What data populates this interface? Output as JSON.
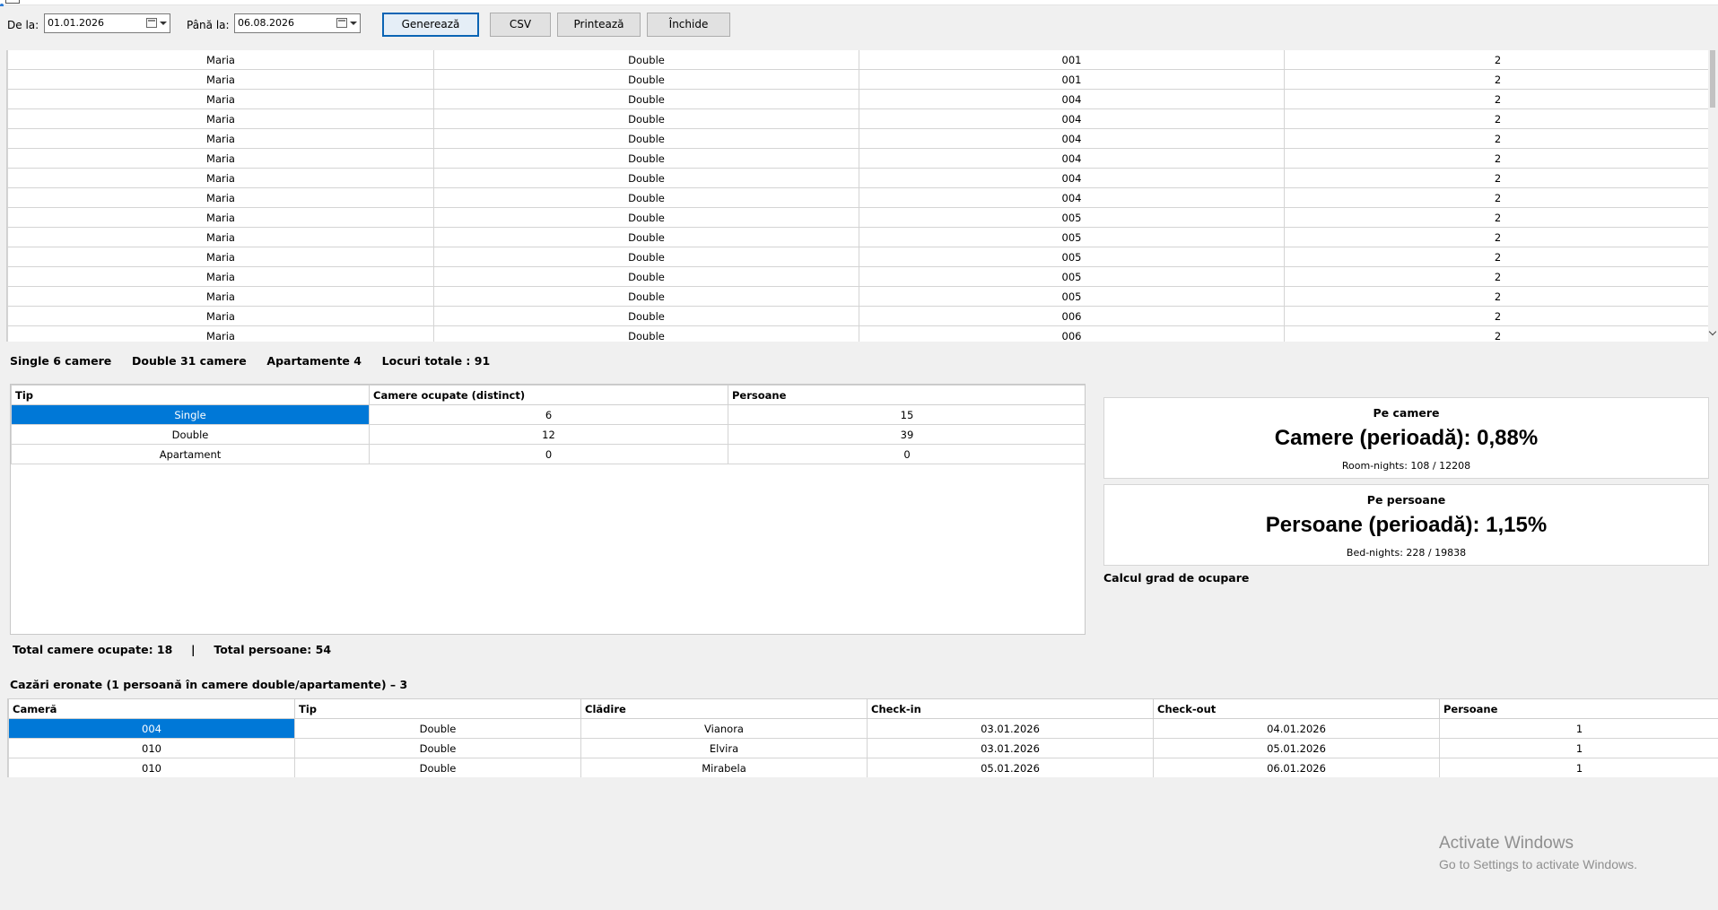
{
  "toolbar": {
    "from_label": "De la:",
    "from_value": "01.01.2026",
    "to_label": "Până la:",
    "to_value": "06.08.2026",
    "generate_label": "Generează",
    "csv_label": "CSV",
    "print_label": "Printează",
    "close_label": "Închide"
  },
  "main_grid": {
    "rows": [
      [
        "Maria",
        "Double",
        "001",
        "2"
      ],
      [
        "Maria",
        "Double",
        "001",
        "2"
      ],
      [
        "Maria",
        "Double",
        "004",
        "2"
      ],
      [
        "Maria",
        "Double",
        "004",
        "2"
      ],
      [
        "Maria",
        "Double",
        "004",
        "2"
      ],
      [
        "Maria",
        "Double",
        "004",
        "2"
      ],
      [
        "Maria",
        "Double",
        "004",
        "2"
      ],
      [
        "Maria",
        "Double",
        "004",
        "2"
      ],
      [
        "Maria",
        "Double",
        "005",
        "2"
      ],
      [
        "Maria",
        "Double",
        "005",
        "2"
      ],
      [
        "Maria",
        "Double",
        "005",
        "2"
      ],
      [
        "Maria",
        "Double",
        "005",
        "2"
      ],
      [
        "Maria",
        "Double",
        "005",
        "2"
      ],
      [
        "Maria",
        "Double",
        "006",
        "2"
      ],
      [
        "Maria",
        "Double",
        "006",
        "2"
      ]
    ]
  },
  "capacity": {
    "single": "Single 6 camere",
    "double": "Double 31 camere",
    "apartments": "Apartamente 4",
    "total": "Locuri totale : 91"
  },
  "summary": {
    "headers": [
      "Tip",
      "Camere ocupate (distinct)",
      "Persoane"
    ],
    "rows": [
      [
        "Single",
        "6",
        "15"
      ],
      [
        "Double",
        "12",
        "39"
      ],
      [
        "Apartament",
        "0",
        "0"
      ]
    ]
  },
  "rooms_card": {
    "subtitle": "Pe camere",
    "headline": "Camere (perioadă): 0,88%",
    "detail": "Room-nights: 108 / 12208"
  },
  "persons_card": {
    "subtitle": "Pe persoane",
    "headline": "Persoane (perioadă): 1,15%",
    "detail": "Bed-nights: 228 / 19838"
  },
  "occupancy_label": "Calcul grad de ocupare",
  "totals": {
    "rooms": "Total camere ocupate: 18",
    "separator": "|",
    "persons": "Total persoane: 54"
  },
  "errors": {
    "title": "Cazări eronate (1 persoană în camere double/apartamente) – 3",
    "headers": [
      "Cameră",
      "Tip",
      "Clădire",
      "Check-in",
      "Check-out",
      "Persoane"
    ],
    "rows": [
      [
        "004",
        "Double",
        "Vianora",
        "03.01.2026",
        "04.01.2026",
        "1"
      ],
      [
        "010",
        "Double",
        "Elvira",
        "03.01.2026",
        "05.01.2026",
        "1"
      ],
      [
        "010",
        "Double",
        "Mirabela",
        "05.01.2026",
        "06.01.2026",
        "1"
      ]
    ]
  },
  "watermark": {
    "line1": "Activate Windows",
    "line2": "Go to Settings to activate Windows."
  },
  "colors": {
    "selection": "#0078d7",
    "primary_button_border": "#0a64b4"
  }
}
